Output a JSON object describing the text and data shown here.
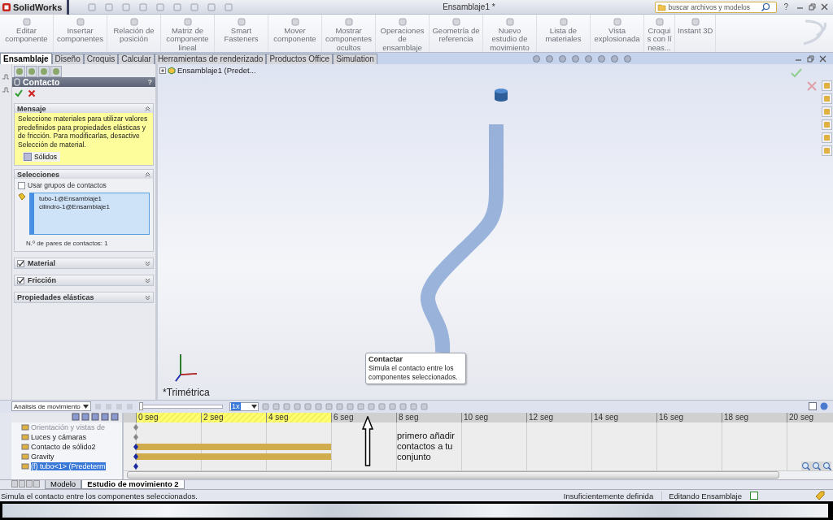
{
  "app": {
    "logo": "SolidWorks",
    "document_title": "Ensamblaje1 *",
    "search": {
      "placeholder": "buscar archivos y modelos"
    },
    "help": "?"
  },
  "ribbon": {
    "tools": [
      {
        "label": "Editar componente"
      },
      {
        "label": "Insertar componentes"
      },
      {
        "label": "Relación de posición"
      },
      {
        "label": "Matriz de componente lineal"
      },
      {
        "label": "Smart Fasteners"
      },
      {
        "label": "Mover componente"
      },
      {
        "label": "Mostrar componentes ocultos"
      },
      {
        "label": "Operaciones de ensamblaje"
      },
      {
        "label": "Geometría de referencia"
      },
      {
        "label": "Nuevo estudio de movimiento"
      },
      {
        "label": "Lista de materiales"
      },
      {
        "label": "Vista explosionada"
      },
      {
        "label": "Croquis con líneas..."
      },
      {
        "label": "Instant 3D"
      }
    ]
  },
  "command_tabs": [
    {
      "label": "Ensamblaje",
      "selected": true
    },
    {
      "label": "Diseño",
      "selected": false
    },
    {
      "label": "Croquis",
      "selected": false
    },
    {
      "label": "Calcular",
      "selected": false
    },
    {
      "label": "Herramientas de renderizado",
      "selected": false
    },
    {
      "label": "Productos Office",
      "selected": false
    },
    {
      "label": "Simulation",
      "selected": false
    }
  ],
  "property_manager": {
    "title": "Contacto",
    "help": "?",
    "message": {
      "title": "Mensaje",
      "text": "Seleccione materiales para utilizar valores predefinidos para propiedades elásticas y de fricción. Para modificarlas, desactive Selección de material.",
      "button": "Sólidos"
    },
    "selections": {
      "title": "Selecciones",
      "option": {
        "label": "Usar grupos de contactos",
        "checked": false
      },
      "items": [
        "tubo-1@Ensamblaje1",
        "cilindro-1@Ensamblaje1"
      ],
      "count": "N.º de pares de contactos: 1"
    },
    "sections": [
      {
        "kind": "check",
        "title": "Material",
        "checked": true
      },
      {
        "kind": "check",
        "title": "Fricción",
        "checked": true
      },
      {
        "kind": "plain",
        "title": "Propiedades elásticas"
      }
    ]
  },
  "viewport": {
    "tree_root": "Ensamblaje1 (Predet...",
    "view_name": "*Trimétrica",
    "tooltip": {
      "title": "Contactar",
      "text": "Simula el contacto entre los componentes seleccionados."
    }
  },
  "motion": {
    "study_type": "Análisis de movimiento",
    "playback": {
      "level": 0
    },
    "speed": "1x",
    "time_labels": [
      "0 seg",
      "2 seg",
      "4 seg",
      "6 seg",
      "8 seg",
      "10 seg",
      "12 seg",
      "14 seg",
      "16 seg",
      "18 seg",
      "20 seg"
    ],
    "rows": [
      {
        "label": "Orientación y vistas de",
        "disabled": true,
        "selected": false,
        "bar": false
      },
      {
        "label": "Luces y cámaras",
        "disabled": false,
        "selected": false,
        "bar": false
      },
      {
        "label": "Contacto de sólido2",
        "disabled": false,
        "selected": false,
        "bar": true
      },
      {
        "label": "Gravity",
        "disabled": false,
        "selected": false,
        "bar": true
      },
      {
        "label": "(f) tubo<1> (Predeterm",
        "disabled": false,
        "selected": true,
        "bar": false
      }
    ],
    "annotation": "primero añadir contactos a tu conjunto"
  },
  "sheet_tabs": [
    {
      "label": "Modelo",
      "selected": false
    },
    {
      "label": "Estudio de movimiento 2",
      "selected": true
    }
  ],
  "status_bar": {
    "message": "Simula el contacto entre los componentes seleccionados.",
    "state": "Insuficientemente definida",
    "mode": "Editando Ensamblaje"
  }
}
